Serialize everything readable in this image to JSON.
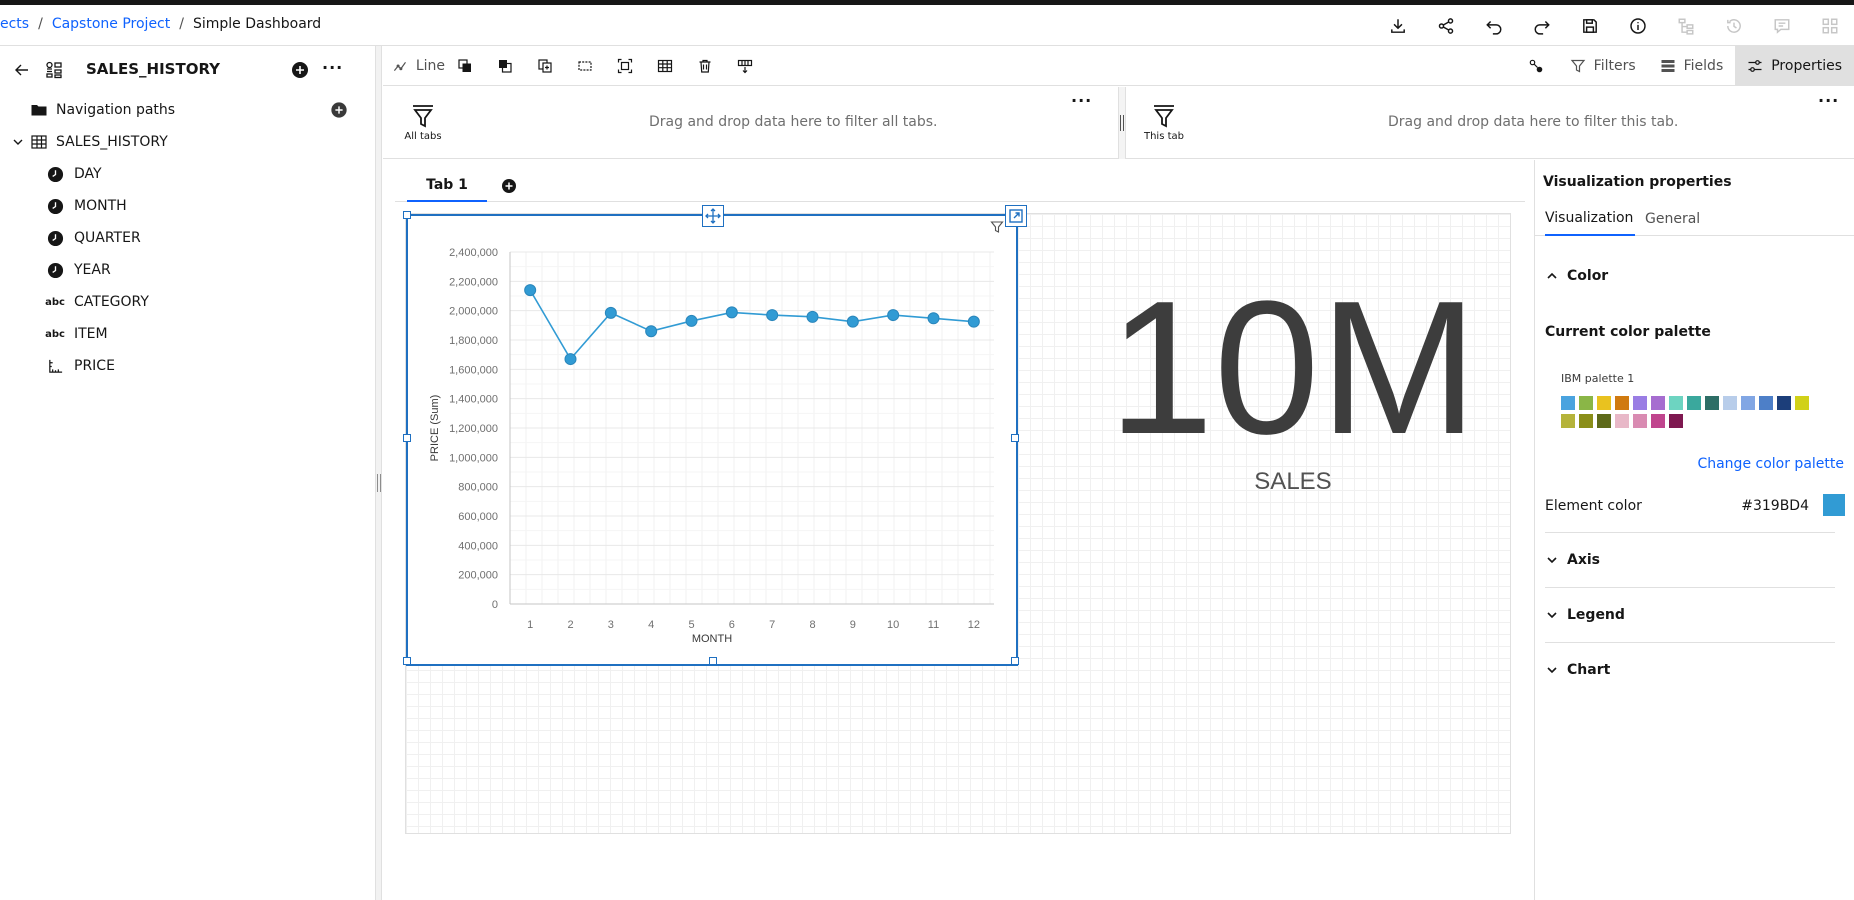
{
  "breadcrumb": {
    "item1": "ects",
    "item2": "Capstone Project",
    "current": "Simple Dashboard",
    "separator": "/"
  },
  "header_icons": [
    "download-icon",
    "share-icon",
    "undo-icon",
    "redo-icon",
    "save-icon",
    "info-icon",
    "hierarchy-icon",
    "history-icon",
    "comment-icon",
    "grid-icon"
  ],
  "left_panel": {
    "title": "SALES_HISTORY",
    "more": "···",
    "navigation_paths": "Navigation paths",
    "table": "SALES_HISTORY",
    "fields": [
      {
        "label": "DAY",
        "icon": "time-icon"
      },
      {
        "label": "MONTH",
        "icon": "time-icon"
      },
      {
        "label": "QUARTER",
        "icon": "time-icon"
      },
      {
        "label": "YEAR",
        "icon": "time-icon"
      },
      {
        "label": "CATEGORY",
        "icon": "text-icon",
        "icon_text": "abc"
      },
      {
        "label": "ITEM",
        "icon": "text-icon",
        "icon_text": "abc"
      },
      {
        "label": "PRICE",
        "icon": "measure-icon"
      }
    ]
  },
  "toolbar": {
    "line_label": "Line",
    "filters": "Filters",
    "fields": "Fields",
    "properties": "Properties"
  },
  "filters": {
    "all_tabs_label": "All tabs",
    "all_tabs_hint": "Drag and drop data here to filter all tabs.",
    "this_tab_label": "This tab",
    "this_tab_hint": "Drag and drop data here to filter this tab.",
    "more": "···"
  },
  "tabs": {
    "tab1": "Tab 1"
  },
  "kpi": {
    "value": "10M",
    "label": "SALES"
  },
  "chart_data": {
    "type": "line",
    "x": [
      1,
      2,
      3,
      4,
      5,
      6,
      7,
      8,
      9,
      10,
      11,
      12
    ],
    "values": [
      2140000,
      1670000,
      1985000,
      1860000,
      1930000,
      1988000,
      1970000,
      1958000,
      1925000,
      1970000,
      1948000,
      1925000
    ],
    "xlabel": "MONTH",
    "ylabel": "PRICE (Sum)",
    "ylim": [
      0,
      2400000
    ],
    "yticks": [
      "2,400,000",
      "2,200,000",
      "2,000,000",
      "1,800,000",
      "1,600,000",
      "1,400,000",
      "1,200,000",
      "1,000,000",
      "800,000",
      "600,000",
      "400,000",
      "200,000",
      "0"
    ],
    "grid": true,
    "line_color": "#319BD4"
  },
  "properties": {
    "title": "Visualization properties",
    "tab_visualization": "Visualization",
    "tab_general": "General",
    "section_color": "Color",
    "current_palette_label": "Current color palette",
    "palette_name": "IBM palette 1",
    "palette_colors": [
      [
        "#4aa3df",
        "#8ab647",
        "#e9c21f",
        "#d07a10",
        "#9a7de4",
        "#a66dd0",
        "#6dd4c1",
        "#3aa89d",
        "#2e6e66",
        "#b8cdea",
        "#81a6e4",
        "#4d7fc8",
        "#1c3e7a",
        "#d1d118"
      ],
      [
        "#b5b33a",
        "#8a8e19",
        "#5e6a1a",
        "#e8b8c8",
        "#d98bb2",
        "#c0458e",
        "#7e1850"
      ]
    ],
    "change_palette": "Change color palette",
    "element_color_label": "Element color",
    "element_color_value": "#319BD4",
    "section_axis": "Axis",
    "section_legend": "Legend",
    "section_chart": "Chart"
  }
}
